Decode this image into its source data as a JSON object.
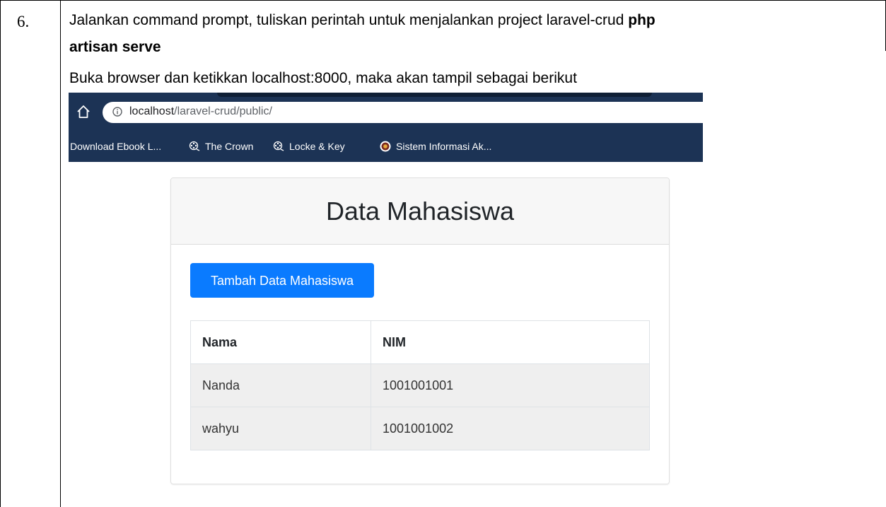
{
  "document": {
    "step_number": "6.",
    "line1_text": "Jalankan command prompt, tuliskan perintah untuk menjalankan project laravel-crud ",
    "line1_bold": "php",
    "line2_bold": "artisan serve",
    "line3_text": "Buka browser dan ketikkan localhost:8000, maka akan tampil sebagai berikut"
  },
  "browser": {
    "url_host": "localhost",
    "url_path": "/laravel-crud/public/",
    "bookmarks": [
      {
        "label": "Download Ebook L...",
        "icon": "none"
      },
      {
        "label": "The Crown",
        "icon": "film-reel-icon"
      },
      {
        "label": "Locke & Key",
        "icon": "film-reel-icon"
      },
      {
        "label": "Sistem Informasi Ak...",
        "icon": "university-logo-icon"
      }
    ]
  },
  "app": {
    "title": "Data Mahasiswa",
    "add_button_label": "Tambah Data Mahasiswa",
    "table": {
      "headers": [
        "Nama",
        "NIM"
      ],
      "rows": [
        [
          "Nanda",
          "1001001001"
        ],
        [
          "wahyu",
          "1001001002"
        ]
      ]
    }
  },
  "colors": {
    "browser_bg": "#1c3355",
    "primary_button": "#0a7bff",
    "card_header_bg": "#f7f7f7",
    "row_bg": "#efefef"
  }
}
